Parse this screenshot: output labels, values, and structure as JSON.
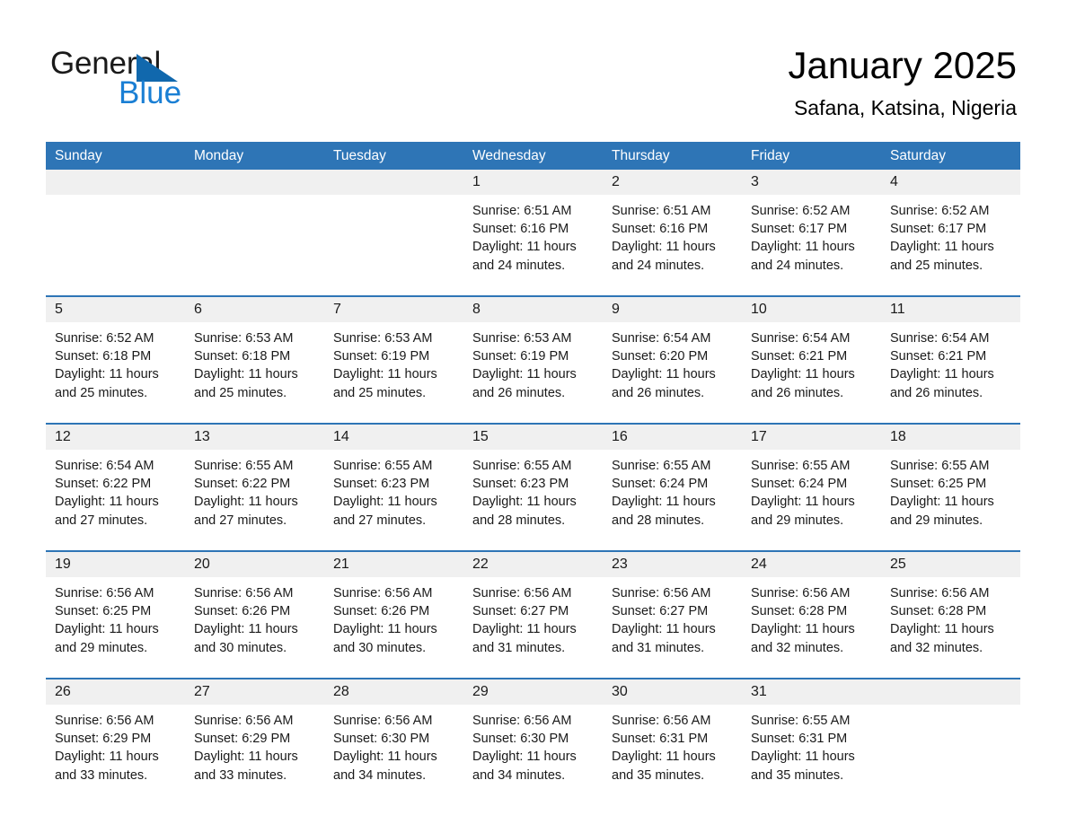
{
  "brand": {
    "name_part1": "General",
    "name_part2": "Blue",
    "logo_icon": "triangle-icon"
  },
  "header": {
    "title": "January 2025",
    "subtitle": "Safana, Katsina, Nigeria"
  },
  "colors": {
    "header_blue": "#2e75b6",
    "brand_blue": "#1a7fd4",
    "logo_blue": "#1168ad",
    "day_bar_gray": "#f0f0f0"
  },
  "weekdays": [
    "Sunday",
    "Monday",
    "Tuesday",
    "Wednesday",
    "Thursday",
    "Friday",
    "Saturday"
  ],
  "weeks": [
    [
      {
        "day": "",
        "sunrise": "",
        "sunset": "",
        "daylight_line1": "",
        "daylight_line2": ""
      },
      {
        "day": "",
        "sunrise": "",
        "sunset": "",
        "daylight_line1": "",
        "daylight_line2": ""
      },
      {
        "day": "",
        "sunrise": "",
        "sunset": "",
        "daylight_line1": "",
        "daylight_line2": ""
      },
      {
        "day": "1",
        "sunrise": "Sunrise: 6:51 AM",
        "sunset": "Sunset: 6:16 PM",
        "daylight_line1": "Daylight: 11 hours",
        "daylight_line2": "and 24 minutes."
      },
      {
        "day": "2",
        "sunrise": "Sunrise: 6:51 AM",
        "sunset": "Sunset: 6:16 PM",
        "daylight_line1": "Daylight: 11 hours",
        "daylight_line2": "and 24 minutes."
      },
      {
        "day": "3",
        "sunrise": "Sunrise: 6:52 AM",
        "sunset": "Sunset: 6:17 PM",
        "daylight_line1": "Daylight: 11 hours",
        "daylight_line2": "and 24 minutes."
      },
      {
        "day": "4",
        "sunrise": "Sunrise: 6:52 AM",
        "sunset": "Sunset: 6:17 PM",
        "daylight_line1": "Daylight: 11 hours",
        "daylight_line2": "and 25 minutes."
      }
    ],
    [
      {
        "day": "5",
        "sunrise": "Sunrise: 6:52 AM",
        "sunset": "Sunset: 6:18 PM",
        "daylight_line1": "Daylight: 11 hours",
        "daylight_line2": "and 25 minutes."
      },
      {
        "day": "6",
        "sunrise": "Sunrise: 6:53 AM",
        "sunset": "Sunset: 6:18 PM",
        "daylight_line1": "Daylight: 11 hours",
        "daylight_line2": "and 25 minutes."
      },
      {
        "day": "7",
        "sunrise": "Sunrise: 6:53 AM",
        "sunset": "Sunset: 6:19 PM",
        "daylight_line1": "Daylight: 11 hours",
        "daylight_line2": "and 25 minutes."
      },
      {
        "day": "8",
        "sunrise": "Sunrise: 6:53 AM",
        "sunset": "Sunset: 6:19 PM",
        "daylight_line1": "Daylight: 11 hours",
        "daylight_line2": "and 26 minutes."
      },
      {
        "day": "9",
        "sunrise": "Sunrise: 6:54 AM",
        "sunset": "Sunset: 6:20 PM",
        "daylight_line1": "Daylight: 11 hours",
        "daylight_line2": "and 26 minutes."
      },
      {
        "day": "10",
        "sunrise": "Sunrise: 6:54 AM",
        "sunset": "Sunset: 6:21 PM",
        "daylight_line1": "Daylight: 11 hours",
        "daylight_line2": "and 26 minutes."
      },
      {
        "day": "11",
        "sunrise": "Sunrise: 6:54 AM",
        "sunset": "Sunset: 6:21 PM",
        "daylight_line1": "Daylight: 11 hours",
        "daylight_line2": "and 26 minutes."
      }
    ],
    [
      {
        "day": "12",
        "sunrise": "Sunrise: 6:54 AM",
        "sunset": "Sunset: 6:22 PM",
        "daylight_line1": "Daylight: 11 hours",
        "daylight_line2": "and 27 minutes."
      },
      {
        "day": "13",
        "sunrise": "Sunrise: 6:55 AM",
        "sunset": "Sunset: 6:22 PM",
        "daylight_line1": "Daylight: 11 hours",
        "daylight_line2": "and 27 minutes."
      },
      {
        "day": "14",
        "sunrise": "Sunrise: 6:55 AM",
        "sunset": "Sunset: 6:23 PM",
        "daylight_line1": "Daylight: 11 hours",
        "daylight_line2": "and 27 minutes."
      },
      {
        "day": "15",
        "sunrise": "Sunrise: 6:55 AM",
        "sunset": "Sunset: 6:23 PM",
        "daylight_line1": "Daylight: 11 hours",
        "daylight_line2": "and 28 minutes."
      },
      {
        "day": "16",
        "sunrise": "Sunrise: 6:55 AM",
        "sunset": "Sunset: 6:24 PM",
        "daylight_line1": "Daylight: 11 hours",
        "daylight_line2": "and 28 minutes."
      },
      {
        "day": "17",
        "sunrise": "Sunrise: 6:55 AM",
        "sunset": "Sunset: 6:24 PM",
        "daylight_line1": "Daylight: 11 hours",
        "daylight_line2": "and 29 minutes."
      },
      {
        "day": "18",
        "sunrise": "Sunrise: 6:55 AM",
        "sunset": "Sunset: 6:25 PM",
        "daylight_line1": "Daylight: 11 hours",
        "daylight_line2": "and 29 minutes."
      }
    ],
    [
      {
        "day": "19",
        "sunrise": "Sunrise: 6:56 AM",
        "sunset": "Sunset: 6:25 PM",
        "daylight_line1": "Daylight: 11 hours",
        "daylight_line2": "and 29 minutes."
      },
      {
        "day": "20",
        "sunrise": "Sunrise: 6:56 AM",
        "sunset": "Sunset: 6:26 PM",
        "daylight_line1": "Daylight: 11 hours",
        "daylight_line2": "and 30 minutes."
      },
      {
        "day": "21",
        "sunrise": "Sunrise: 6:56 AM",
        "sunset": "Sunset: 6:26 PM",
        "daylight_line1": "Daylight: 11 hours",
        "daylight_line2": "and 30 minutes."
      },
      {
        "day": "22",
        "sunrise": "Sunrise: 6:56 AM",
        "sunset": "Sunset: 6:27 PM",
        "daylight_line1": "Daylight: 11 hours",
        "daylight_line2": "and 31 minutes."
      },
      {
        "day": "23",
        "sunrise": "Sunrise: 6:56 AM",
        "sunset": "Sunset: 6:27 PM",
        "daylight_line1": "Daylight: 11 hours",
        "daylight_line2": "and 31 minutes."
      },
      {
        "day": "24",
        "sunrise": "Sunrise: 6:56 AM",
        "sunset": "Sunset: 6:28 PM",
        "daylight_line1": "Daylight: 11 hours",
        "daylight_line2": "and 32 minutes."
      },
      {
        "day": "25",
        "sunrise": "Sunrise: 6:56 AM",
        "sunset": "Sunset: 6:28 PM",
        "daylight_line1": "Daylight: 11 hours",
        "daylight_line2": "and 32 minutes."
      }
    ],
    [
      {
        "day": "26",
        "sunrise": "Sunrise: 6:56 AM",
        "sunset": "Sunset: 6:29 PM",
        "daylight_line1": "Daylight: 11 hours",
        "daylight_line2": "and 33 minutes."
      },
      {
        "day": "27",
        "sunrise": "Sunrise: 6:56 AM",
        "sunset": "Sunset: 6:29 PM",
        "daylight_line1": "Daylight: 11 hours",
        "daylight_line2": "and 33 minutes."
      },
      {
        "day": "28",
        "sunrise": "Sunrise: 6:56 AM",
        "sunset": "Sunset: 6:30 PM",
        "daylight_line1": "Daylight: 11 hours",
        "daylight_line2": "and 34 minutes."
      },
      {
        "day": "29",
        "sunrise": "Sunrise: 6:56 AM",
        "sunset": "Sunset: 6:30 PM",
        "daylight_line1": "Daylight: 11 hours",
        "daylight_line2": "and 34 minutes."
      },
      {
        "day": "30",
        "sunrise": "Sunrise: 6:56 AM",
        "sunset": "Sunset: 6:31 PM",
        "daylight_line1": "Daylight: 11 hours",
        "daylight_line2": "and 35 minutes."
      },
      {
        "day": "31",
        "sunrise": "Sunrise: 6:55 AM",
        "sunset": "Sunset: 6:31 PM",
        "daylight_line1": "Daylight: 11 hours",
        "daylight_line2": "and 35 minutes."
      },
      {
        "day": "",
        "sunrise": "",
        "sunset": "",
        "daylight_line1": "",
        "daylight_line2": ""
      }
    ]
  ]
}
